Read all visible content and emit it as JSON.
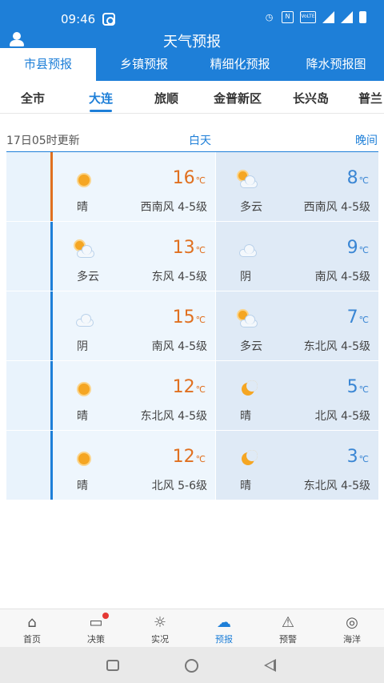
{
  "status_bar": {
    "time": "09:46",
    "icons": [
      "alarm-icon",
      "nfc-icon",
      "volte-icon",
      "signal-icon",
      "4g-signal-icon",
      "battery-icon"
    ],
    "volte": "VoLTE",
    "net": "4G"
  },
  "header": {
    "title": "天气预报",
    "user_icon": "user-icon"
  },
  "tabs": [
    {
      "label": "市县预报",
      "active": true
    },
    {
      "label": "乡镇预报",
      "active": false
    },
    {
      "label": "精细化预报",
      "active": false
    },
    {
      "label": "降水预报图",
      "active": false
    }
  ],
  "regions": [
    "全市",
    "大连",
    "旅顺",
    "金普新区",
    "长兴岛",
    "普兰"
  ],
  "active_region": "大连",
  "update": {
    "text": "17日05时更新",
    "day_label": "白天",
    "night_label": "晚间"
  },
  "temp_unit": "℃",
  "forecast": [
    {
      "day": {
        "icon": "sunny-icon",
        "weather": "晴",
        "temp": "16",
        "wind": "西南风 4-5级"
      },
      "night": {
        "icon": "partly-cloudy-icon",
        "weather": "多云",
        "temp": "8",
        "wind": "西南风 4-5级"
      }
    },
    {
      "day": {
        "icon": "partly-cloudy-icon",
        "weather": "多云",
        "temp": "13",
        "wind": "东风 4-5级"
      },
      "night": {
        "icon": "cloudy-icon",
        "weather": "阴",
        "temp": "9",
        "wind": "南风 4-5级"
      }
    },
    {
      "day": {
        "icon": "cloudy-icon",
        "weather": "阴",
        "temp": "15",
        "wind": "南风 4-5级"
      },
      "night": {
        "icon": "partly-cloudy-icon",
        "weather": "多云",
        "temp": "7",
        "wind": "东北风 4-5级"
      }
    },
    {
      "day": {
        "icon": "sunny-icon",
        "weather": "晴",
        "temp": "12",
        "wind": "东北风 4-5级"
      },
      "night": {
        "icon": "moon-icon",
        "weather": "晴",
        "temp": "5",
        "wind": "北风 4-5级"
      }
    },
    {
      "day": {
        "icon": "sunny-icon",
        "weather": "晴",
        "temp": "12",
        "wind": "北风 5-6级"
      },
      "night": {
        "icon": "moon-icon",
        "weather": "晴",
        "temp": "3",
        "wind": "东北风 4-5级"
      }
    }
  ],
  "bottom_nav": [
    {
      "label": "首页",
      "icon": "home-icon",
      "active": false
    },
    {
      "label": "决策",
      "icon": "message-icon",
      "active": false,
      "badge": true
    },
    {
      "label": "实况",
      "icon": "sun-outline-icon",
      "active": false
    },
    {
      "label": "预报",
      "icon": "cloud-sun-icon",
      "active": true
    },
    {
      "label": "预警",
      "icon": "alert-icon",
      "active": false
    },
    {
      "label": "海洋",
      "icon": "wave-icon",
      "active": false
    }
  ],
  "colors": {
    "primary": "#1e7fd8",
    "day_temp": "#e07020",
    "night_temp": "#3a86d4"
  }
}
